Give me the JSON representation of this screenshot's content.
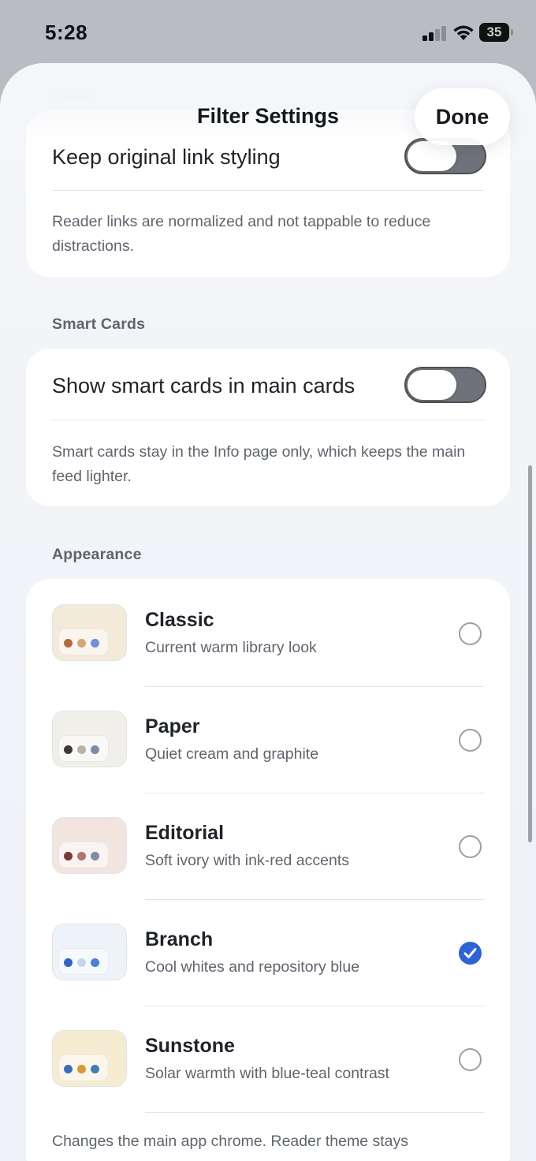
{
  "status_bar": {
    "time": "5:28",
    "battery": "35"
  },
  "sheet": {
    "title": "Filter Settings",
    "done_label": "Done",
    "ghost_header": "Reader"
  },
  "reader_card": {
    "toggle_label": "Keep original link styling",
    "toggle_on": false,
    "help": "Reader links are normalized and not tappable to reduce distractions."
  },
  "smart_cards": {
    "header": "Smart Cards",
    "toggle_label": "Show smart cards in main cards",
    "toggle_on": false,
    "help": "Smart cards stay in the Info page only, which keeps the main feed lighter."
  },
  "appearance": {
    "header": "Appearance",
    "accent_color": "#2c63d6",
    "themes": [
      {
        "name": "Classic",
        "desc": "Current warm library look",
        "selected": false,
        "bg": "#f3ead9",
        "dots": [
          "#b46a3c",
          "#cfa77a",
          "#6f8fd8"
        ]
      },
      {
        "name": "Paper",
        "desc": "Quiet cream and graphite",
        "selected": false,
        "bg": "#f1efea",
        "dots": [
          "#3a3a3a",
          "#b8b3a8",
          "#7e8ca8"
        ]
      },
      {
        "name": "Editorial",
        "desc": "Soft ivory with ink-red accents",
        "selected": false,
        "bg": "#f2e5df",
        "dots": [
          "#7a3b35",
          "#b0766b",
          "#7e8ca8"
        ]
      },
      {
        "name": "Branch",
        "desc": "Cool whites and repository blue",
        "selected": true,
        "bg": "#eef3fa",
        "dots": [
          "#2f63c8",
          "#c4d4ee",
          "#4b7fd8"
        ]
      },
      {
        "name": "Sunstone",
        "desc": "Solar warmth with blue-teal contrast",
        "selected": false,
        "bg": "#f5ecd2",
        "dots": [
          "#3a6fb7",
          "#d49a3a",
          "#3f7fb5"
        ]
      }
    ],
    "footer": "Changes the main app chrome. Reader theme stays"
  }
}
